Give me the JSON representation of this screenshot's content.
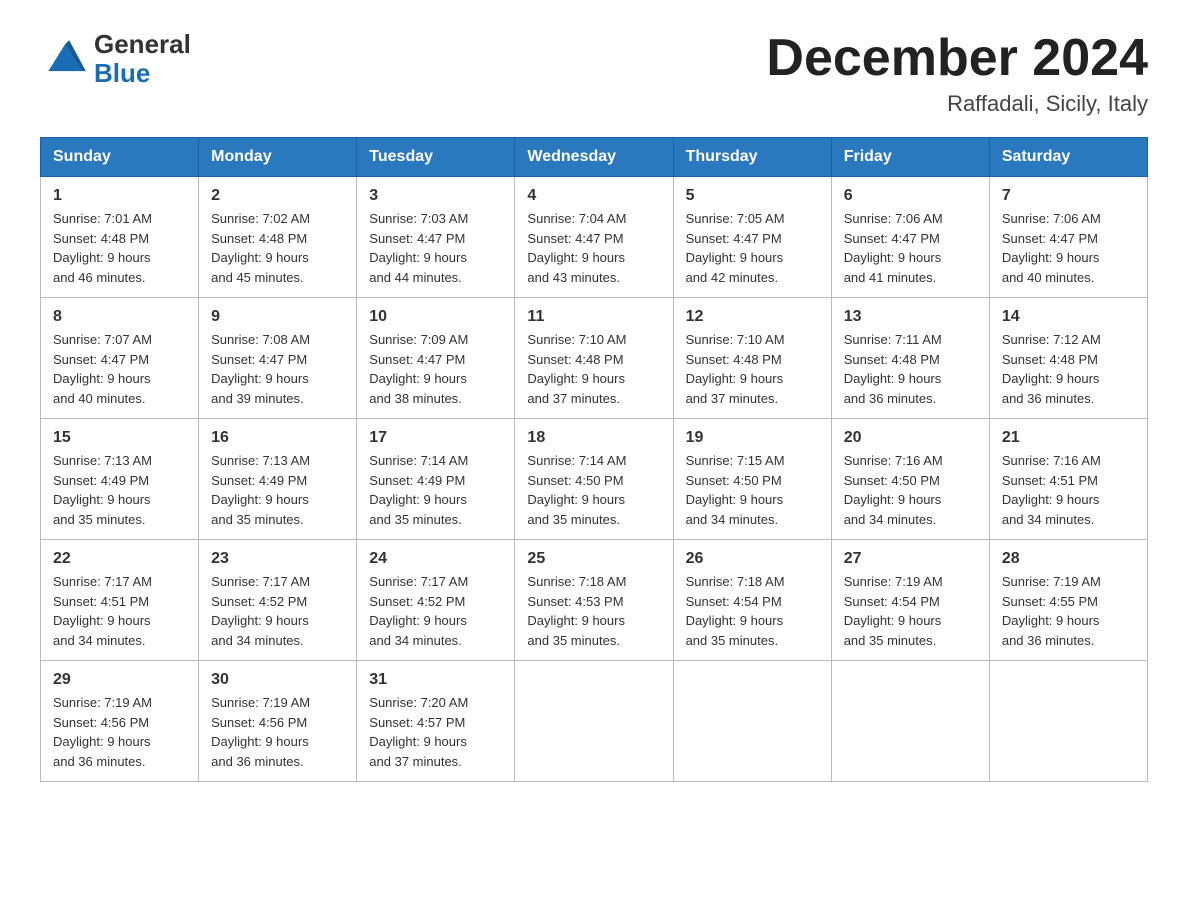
{
  "header": {
    "logo_general": "General",
    "logo_blue": "Blue",
    "month_title": "December 2024",
    "location": "Raffadali, Sicily, Italy"
  },
  "days_of_week": [
    "Sunday",
    "Monday",
    "Tuesday",
    "Wednesday",
    "Thursday",
    "Friday",
    "Saturday"
  ],
  "weeks": [
    [
      {
        "date": "1",
        "sunrise": "7:01 AM",
        "sunset": "4:48 PM",
        "daylight": "9 hours and 46 minutes."
      },
      {
        "date": "2",
        "sunrise": "7:02 AM",
        "sunset": "4:48 PM",
        "daylight": "9 hours and 45 minutes."
      },
      {
        "date": "3",
        "sunrise": "7:03 AM",
        "sunset": "4:47 PM",
        "daylight": "9 hours and 44 minutes."
      },
      {
        "date": "4",
        "sunrise": "7:04 AM",
        "sunset": "4:47 PM",
        "daylight": "9 hours and 43 minutes."
      },
      {
        "date": "5",
        "sunrise": "7:05 AM",
        "sunset": "4:47 PM",
        "daylight": "9 hours and 42 minutes."
      },
      {
        "date": "6",
        "sunrise": "7:06 AM",
        "sunset": "4:47 PM",
        "daylight": "9 hours and 41 minutes."
      },
      {
        "date": "7",
        "sunrise": "7:06 AM",
        "sunset": "4:47 PM",
        "daylight": "9 hours and 40 minutes."
      }
    ],
    [
      {
        "date": "8",
        "sunrise": "7:07 AM",
        "sunset": "4:47 PM",
        "daylight": "9 hours and 40 minutes."
      },
      {
        "date": "9",
        "sunrise": "7:08 AM",
        "sunset": "4:47 PM",
        "daylight": "9 hours and 39 minutes."
      },
      {
        "date": "10",
        "sunrise": "7:09 AM",
        "sunset": "4:47 PM",
        "daylight": "9 hours and 38 minutes."
      },
      {
        "date": "11",
        "sunrise": "7:10 AM",
        "sunset": "4:48 PM",
        "daylight": "9 hours and 37 minutes."
      },
      {
        "date": "12",
        "sunrise": "7:10 AM",
        "sunset": "4:48 PM",
        "daylight": "9 hours and 37 minutes."
      },
      {
        "date": "13",
        "sunrise": "7:11 AM",
        "sunset": "4:48 PM",
        "daylight": "9 hours and 36 minutes."
      },
      {
        "date": "14",
        "sunrise": "7:12 AM",
        "sunset": "4:48 PM",
        "daylight": "9 hours and 36 minutes."
      }
    ],
    [
      {
        "date": "15",
        "sunrise": "7:13 AM",
        "sunset": "4:49 PM",
        "daylight": "9 hours and 35 minutes."
      },
      {
        "date": "16",
        "sunrise": "7:13 AM",
        "sunset": "4:49 PM",
        "daylight": "9 hours and 35 minutes."
      },
      {
        "date": "17",
        "sunrise": "7:14 AM",
        "sunset": "4:49 PM",
        "daylight": "9 hours and 35 minutes."
      },
      {
        "date": "18",
        "sunrise": "7:14 AM",
        "sunset": "4:50 PM",
        "daylight": "9 hours and 35 minutes."
      },
      {
        "date": "19",
        "sunrise": "7:15 AM",
        "sunset": "4:50 PM",
        "daylight": "9 hours and 34 minutes."
      },
      {
        "date": "20",
        "sunrise": "7:16 AM",
        "sunset": "4:50 PM",
        "daylight": "9 hours and 34 minutes."
      },
      {
        "date": "21",
        "sunrise": "7:16 AM",
        "sunset": "4:51 PM",
        "daylight": "9 hours and 34 minutes."
      }
    ],
    [
      {
        "date": "22",
        "sunrise": "7:17 AM",
        "sunset": "4:51 PM",
        "daylight": "9 hours and 34 minutes."
      },
      {
        "date": "23",
        "sunrise": "7:17 AM",
        "sunset": "4:52 PM",
        "daylight": "9 hours and 34 minutes."
      },
      {
        "date": "24",
        "sunrise": "7:17 AM",
        "sunset": "4:52 PM",
        "daylight": "9 hours and 34 minutes."
      },
      {
        "date": "25",
        "sunrise": "7:18 AM",
        "sunset": "4:53 PM",
        "daylight": "9 hours and 35 minutes."
      },
      {
        "date": "26",
        "sunrise": "7:18 AM",
        "sunset": "4:54 PM",
        "daylight": "9 hours and 35 minutes."
      },
      {
        "date": "27",
        "sunrise": "7:19 AM",
        "sunset": "4:54 PM",
        "daylight": "9 hours and 35 minutes."
      },
      {
        "date": "28",
        "sunrise": "7:19 AM",
        "sunset": "4:55 PM",
        "daylight": "9 hours and 36 minutes."
      }
    ],
    [
      {
        "date": "29",
        "sunrise": "7:19 AM",
        "sunset": "4:56 PM",
        "daylight": "9 hours and 36 minutes."
      },
      {
        "date": "30",
        "sunrise": "7:19 AM",
        "sunset": "4:56 PM",
        "daylight": "9 hours and 36 minutes."
      },
      {
        "date": "31",
        "sunrise": "7:20 AM",
        "sunset": "4:57 PM",
        "daylight": "9 hours and 37 minutes."
      },
      null,
      null,
      null,
      null
    ]
  ],
  "labels": {
    "sunrise": "Sunrise: ",
    "sunset": "Sunset: ",
    "daylight": "Daylight: "
  }
}
